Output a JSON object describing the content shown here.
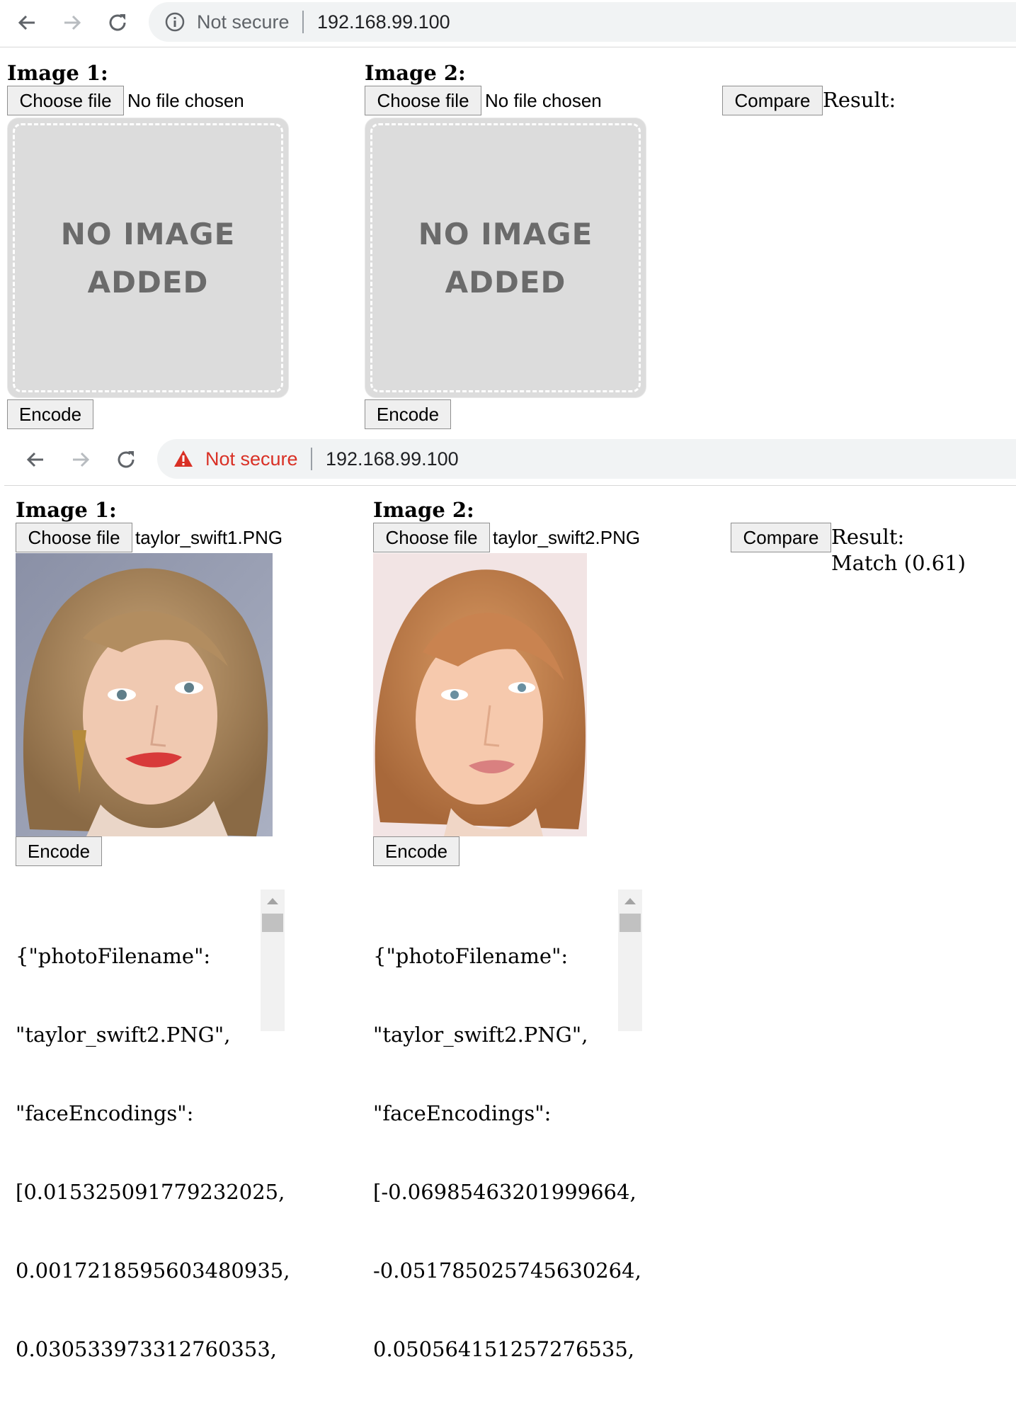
{
  "top": {
    "browser": {
      "security_text": "Not secure",
      "url": "192.168.99.100"
    },
    "image1": {
      "header": "Image 1:",
      "choose_label": "Choose file",
      "file_name": "No file chosen",
      "placeholder_line1": "NO IMAGE",
      "placeholder_line2": "ADDED",
      "encode_label": "Encode"
    },
    "image2": {
      "header": "Image 2:",
      "choose_label": "Choose file",
      "file_name": "No file chosen",
      "placeholder_line1": "NO IMAGE",
      "placeholder_line2": "ADDED",
      "encode_label": "Encode"
    },
    "compare_label": "Compare",
    "result_label": "Result:"
  },
  "bottom": {
    "browser": {
      "security_text": "Not secure",
      "security_color": "#d93025",
      "url": "192.168.99.100"
    },
    "image1": {
      "header": "Image 1:",
      "choose_label": "Choose file",
      "file_name": "taylor_swift1.PNG",
      "encode_label": "Encode",
      "json_lines": [
        "{\"photoFilename\":",
        "\"taylor_swift2.PNG\",",
        "\"faceEncodings\":",
        "[0.015325091779232025,",
        "0.0017218595603480935,",
        "0.030533973312760353,"
      ]
    },
    "image2": {
      "header": "Image 2:",
      "choose_label": "Choose file",
      "file_name": "taylor_swift2.PNG",
      "encode_label": "Encode",
      "json_lines": [
        "{\"photoFilename\":",
        "\"taylor_swift2.PNG\",",
        "\"faceEncodings\":",
        "[-0.06985463201999664,",
        "-0.051785025745630264,",
        "0.050564151257276535,"
      ]
    },
    "compare_label": "Compare",
    "result_label": "Result:",
    "result_value": "Match (0.61)"
  }
}
